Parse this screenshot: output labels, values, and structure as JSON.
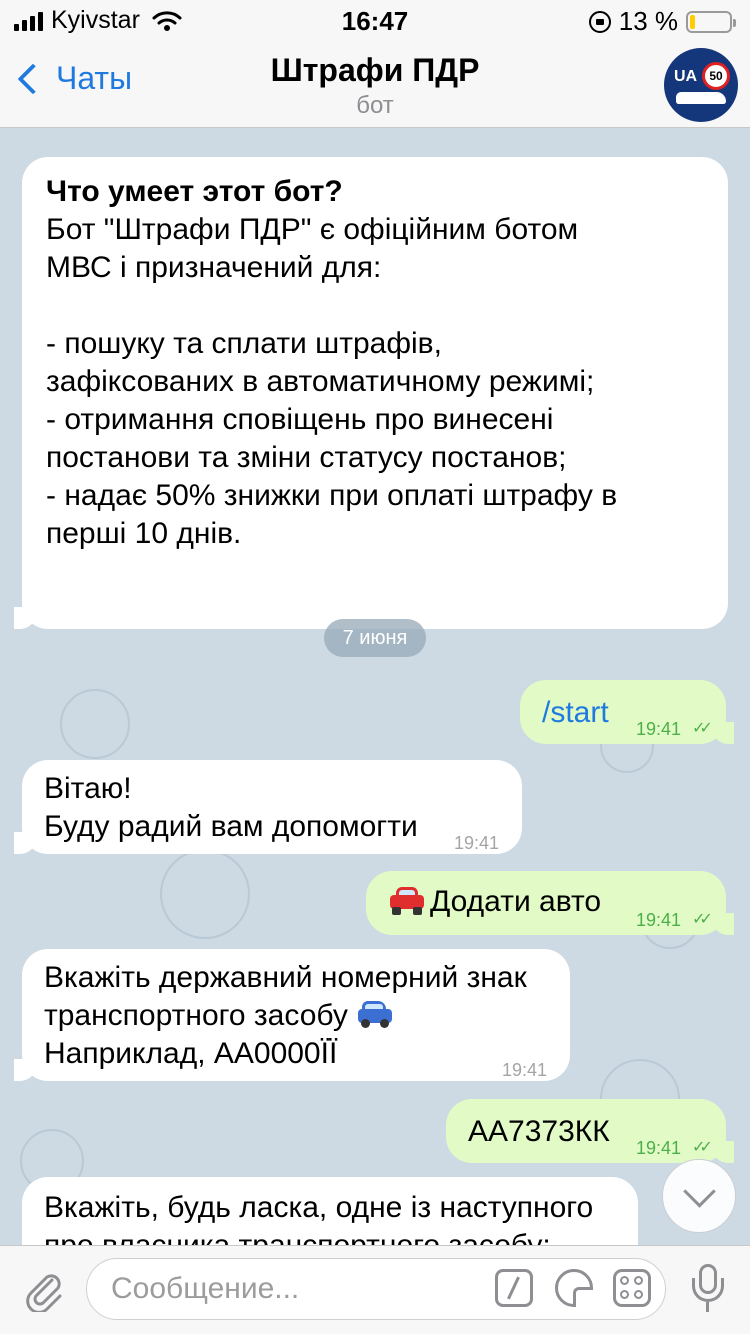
{
  "status_bar": {
    "carrier": "Kyivstar",
    "time": "16:47",
    "battery": "13 %",
    "battery_level": 0.13
  },
  "header": {
    "back_label": "Чаты",
    "title": "Штрафи ПДР",
    "subtitle": "бот",
    "avatar": {
      "badge_text": "UA",
      "sign_text": "50"
    }
  },
  "chat": {
    "intro": {
      "title": "Что умеет этот бот?",
      "body": "Бот \"Штрафи ПДР\" є офіційним ботом\nМВС і призначений для:\n\n- пошуку та сплати штрафів,\nзафіксованих в автоматичному режимі;\n- отримання сповіщень про винесені\nпостанови та зміни статусу постанов;\n- надає 50% знижки при оплаті штрафу в\nперші 10 днів."
    },
    "date_label": "7 июня",
    "messages": [
      {
        "side": "out",
        "text": "/start",
        "time": "19:41",
        "icon": "double-check-icon"
      },
      {
        "side": "in",
        "text": "Вітаю!\nБуду радий вам допомогти",
        "time": "19:41"
      },
      {
        "side": "out",
        "text": "Додати авто",
        "emoji": "red-car-icon",
        "time": "19:41",
        "icon": "double-check-icon"
      },
      {
        "side": "in",
        "text_line1": "Вкажіть державний номерний знак",
        "text_line2": "транспортного засобу",
        "text_line3": "Наприклад, АА0000ЇЇ",
        "emoji": "blue-car-icon",
        "time": "19:41"
      },
      {
        "side": "out",
        "text": "АА7373КК",
        "time": "19:41",
        "icon": "double-check-icon"
      },
      {
        "side": "in",
        "text": "Вкажіть, будь ласка, одне із наступного\nпро власника транспортного засобу:"
      }
    ]
  },
  "input_bar": {
    "placeholder": "Сообщение..."
  },
  "colors": {
    "accent": "#1f7ae0",
    "outgoing_bubble": "#e2fbc6",
    "chat_background": "#cdd9e3",
    "time_outgoing": "#4cb04a"
  }
}
